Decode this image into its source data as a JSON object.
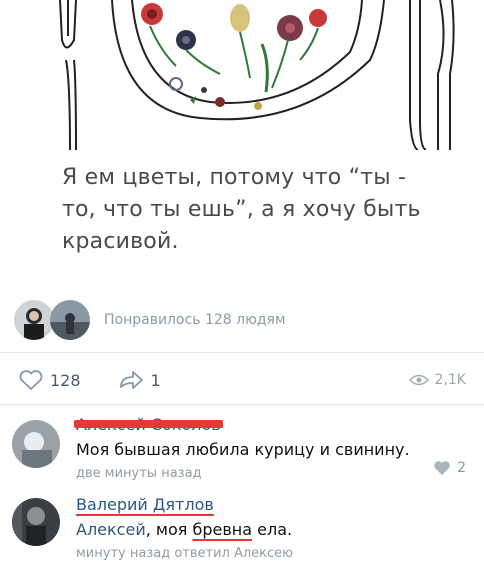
{
  "post": {
    "text": "Я ем цветы, потому что “ты - то, что ты ешь”, а я хочу быть красивой."
  },
  "likers": {
    "text": "Понравилось 128 людям"
  },
  "actions": {
    "likes": "128",
    "reposts": "1",
    "views": "2,1K"
  },
  "comments": [
    {
      "author": "Алексей Соколов",
      "text": "Моя бывшая любила курицу и свинину.",
      "meta": "две минуты назад",
      "likes": "2"
    },
    {
      "author": "Валерий Дятлов",
      "reply_to": "Алексей",
      "text_rest": ", моя ",
      "underlined_word": "бревна",
      "text_end": " ела.",
      "meta": "минуту назад ответил Алексею"
    }
  ],
  "icons": {
    "like": "heart-icon",
    "repost": "repost-icon",
    "views": "eye-icon"
  },
  "colors": {
    "link": "#2a5885",
    "muted": "#8f9aa8",
    "red_mark": "#e53935"
  }
}
